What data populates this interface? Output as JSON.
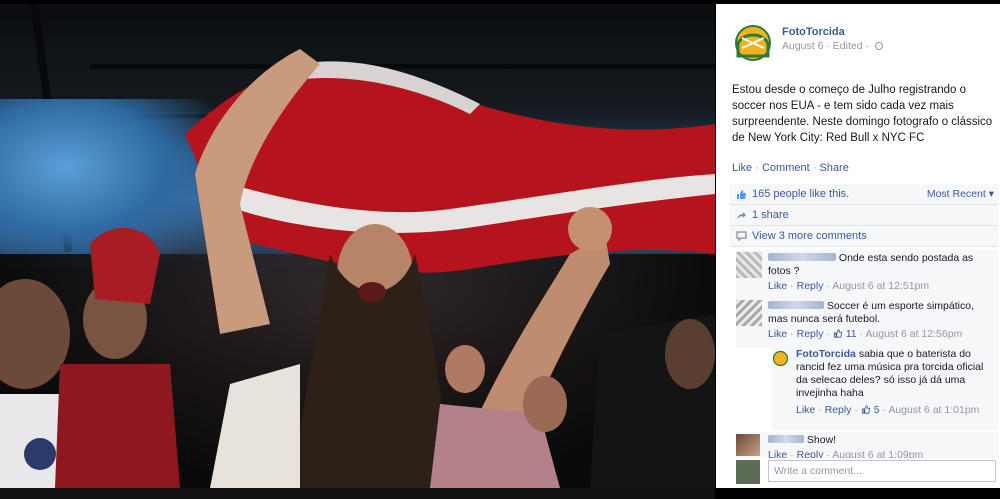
{
  "post": {
    "page_name": "FotoTorcida",
    "date": "August 6",
    "edited": "Edited",
    "text": "Estou desde o começo de Julho registrando o soccer nos EUA - e tem sido cada vez mais surpreendente. Neste domingo fotografo o clássico de New York City: Red Bull x NYC FC",
    "actions": {
      "like": "Like",
      "comment": "Comment",
      "share": "Share"
    }
  },
  "ufi": {
    "likes": "165 people like this.",
    "sort": "Most Recent",
    "shares": "1 share",
    "view_more": "View 3 more comments"
  },
  "comments": [
    {
      "text": "Onde esta sendo postada as fotos ?",
      "like": "Like",
      "reply": "Reply",
      "time": "August 6 at 12:51pm"
    },
    {
      "text": "Soccer é um esporte simpático, mas nunca será futebol.",
      "like": "Like",
      "reply": "Reply",
      "likes_count": "11",
      "time": "August 6 at 12:56pm"
    },
    {
      "text": "Show!",
      "like": "Like",
      "reply": "Reply",
      "time": "August 6 at 1:09pm"
    }
  ],
  "reply": {
    "author": "FotoTorcida",
    "text": "sabia que o baterista do rancid fez uma música pra torcida oficial da selecao deles? só isso já dá uma invejinha haha",
    "like": "Like",
    "reply": "Reply",
    "likes_count": "5",
    "time": "August 6 at 1:01pm"
  },
  "composer": {
    "placeholder": "Write a comment..."
  },
  "colors": {
    "link": "#3b5998",
    "meta": "#9197a3",
    "ufi_bg": "#f6f7f9"
  }
}
